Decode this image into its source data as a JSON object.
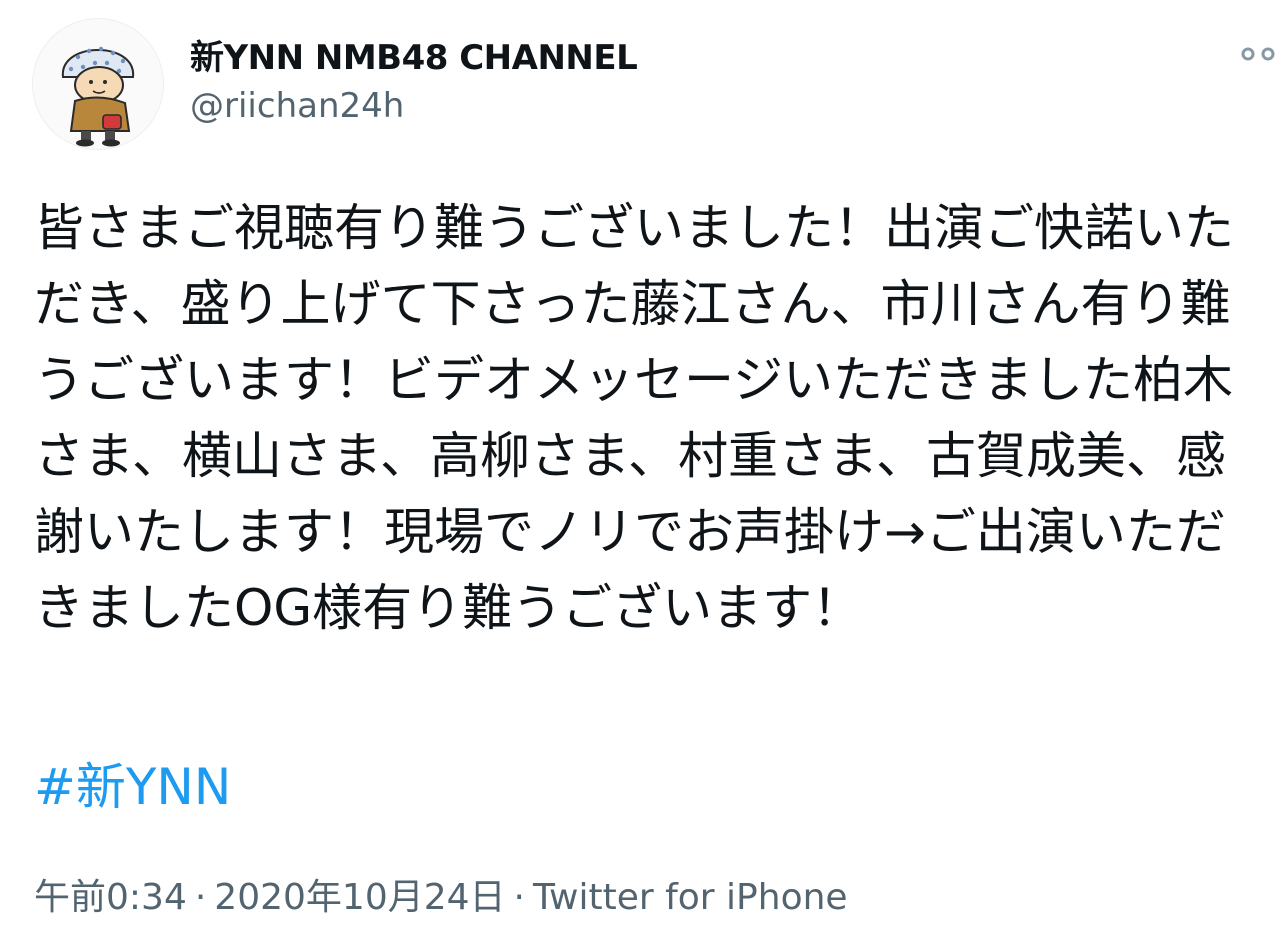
{
  "tweet": {
    "display_name": "新YNN NMB48 CHANNEL",
    "handle": "@riichan24h",
    "text": "皆さまご視聴有り難うございました！出演ご快諾いただき、盛り上げて下さった藤江さん、市川さん有り難うございます！ビデオメッセージいただきました柏木さま、横山さま、高柳さま、村重さま、古賀成美、感謝いたします！現場でノリでお声掛け→ご出演いただきましたOG様有り難うございます！",
    "hashtag": "#新YNN",
    "time": "午前0:34",
    "separator": "·",
    "date": "2020年10月24日",
    "source": "Twitter for iPhone"
  },
  "icons": {
    "avatar": "cartoon-avatar-icon",
    "more": "more-options-icon"
  },
  "colors": {
    "link": "#1d9bf0",
    "secondary_text": "#536471",
    "primary_text": "#0f1419"
  }
}
